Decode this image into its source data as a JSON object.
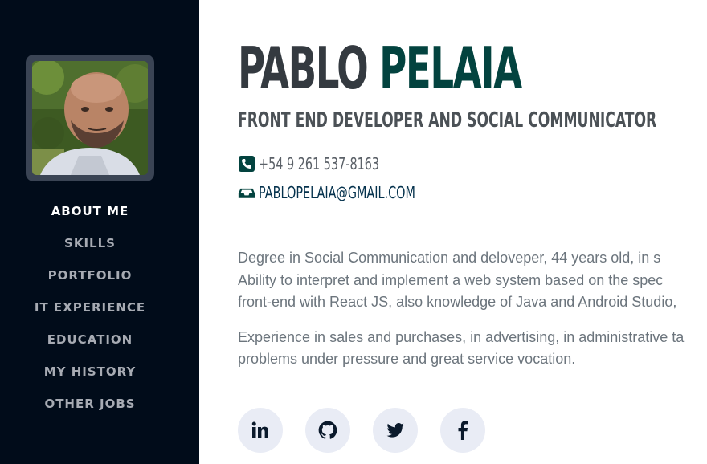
{
  "profile": {
    "first_name": "PABLO",
    "last_name": "PELAIA",
    "subtitle": "FRONT END DEVELOPER AND SOCIAL COMMUNICATOR",
    "phone": "+54 9 261 537-8163",
    "email": "PABLOPELAIA@GMAIL.COM"
  },
  "nav": {
    "items": [
      {
        "label": "ABOUT ME",
        "active": true
      },
      {
        "label": "SKILLS"
      },
      {
        "label": "PORTFOLIO"
      },
      {
        "label": "IT EXPERIENCE"
      },
      {
        "label": "EDUCATION"
      },
      {
        "label": "MY HISTORY"
      },
      {
        "label": "OTHER JOBS"
      }
    ]
  },
  "about": {
    "paragraph1_line1": "Degree in Social Communication and deloveper, 44 years old, in s",
    "paragraph1_line2": "Ability to interpret and implement a web system based on the spec",
    "paragraph1_line3": "front-end with React JS, also knowledge of Java and Android Studio,",
    "paragraph2_line1": "Experience in sales and purchases, in advertising, in administrative ta",
    "paragraph2_line2": "problems under pressure and great service vocation."
  },
  "socials": [
    "linkedin-icon",
    "github-icon",
    "twitter-icon",
    "facebook-icon"
  ],
  "colors": {
    "sidebar_bg": "#010c1a",
    "accent": "#03433f",
    "name_dark": "#343a40",
    "social_bg": "#e9ecf5"
  }
}
